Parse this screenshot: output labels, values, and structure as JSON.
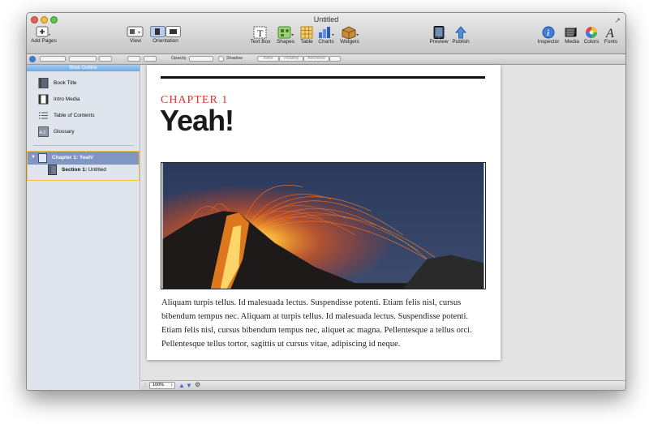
{
  "window": {
    "title": "Untitled"
  },
  "toolbar": {
    "add_pages": "Add Pages",
    "view": "View",
    "orientation": "Orientation",
    "text_box": "Text Box",
    "shapes": "Shapes",
    "table": "Table",
    "charts": "Charts",
    "widgets": "Widgets",
    "preview": "Preview",
    "publish": "Publish",
    "inspector": "Inspector",
    "media": "Media",
    "colors": "Colors",
    "fonts": "Fonts"
  },
  "format_bar": {
    "opacity_label": "Opacity",
    "shadow_label": "Shadow",
    "wrap_options": [
      "Inline",
      "Floating",
      "Anchored"
    ]
  },
  "sidebar": {
    "header": "Book Outline",
    "items": [
      {
        "label": "Book Title",
        "icon": "book-cover-icon"
      },
      {
        "label": "Intro Media",
        "icon": "film-icon"
      },
      {
        "label": "Table of Contents",
        "icon": "list-icon"
      },
      {
        "label": "Glossary",
        "icon": "glossary-icon",
        "glyph": "A-Z"
      }
    ],
    "chapter": {
      "prefix": "Chapter 1:",
      "title": "Yeah!"
    },
    "section": {
      "prefix": "Section 1:",
      "title": "Untitled"
    },
    "selection_color": "#f3c23a",
    "chapter_color": "#7f95c2"
  },
  "page": {
    "chapter_label": "CHAPTER 1",
    "chapter_label_color": "#d43a2c",
    "heading": "Yeah!",
    "body": "Aliquam turpis tellus. Id malesuada lectus. Suspendisse potenti. Etiam felis nisl, cursus bibendum tempus nec. Aliquam at turpis tellus. Id malesuada lectus. Suspendisse potenti. Etiam felis nisl, cursus bibendum tempus nec, aliquet ac magna. Pellentesque a tellus orci. Pellentesque tellus tortor, sagittis ut cursus vitae, adipiscing id neque."
  },
  "statusbar": {
    "zoom": "100%"
  }
}
